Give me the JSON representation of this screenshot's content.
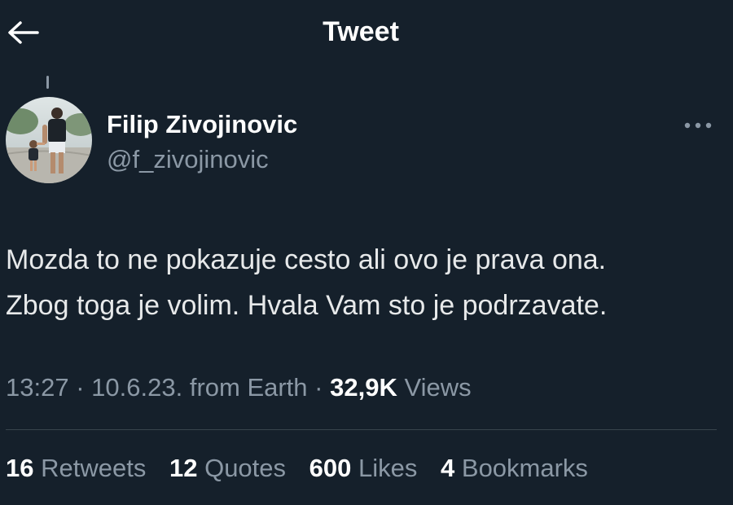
{
  "header": {
    "title": "Tweet",
    "back_icon": "arrow-left-icon"
  },
  "tweet": {
    "author": {
      "display_name": "Filip Zivojinovic",
      "handle": "@f_zivojinovic",
      "avatar_icon": "profile-photo"
    },
    "more_icon": "more-options-icon",
    "text_lines": [
      "Mozda to ne pokazuje cesto ali ovo je prava ona.",
      "Zbog toga je volim. Hvala Vam sto je podrzavate."
    ],
    "time": "13:27",
    "date": "10.6.23.",
    "source": "from Earth",
    "sep": "·",
    "views_count": "32,9K",
    "views_label": "Views"
  },
  "stats": {
    "retweets": {
      "count": "16",
      "label": "Retweets"
    },
    "quotes": {
      "count": "12",
      "label": "Quotes"
    },
    "likes": {
      "count": "600",
      "label": "Likes"
    },
    "bookmarks": {
      "count": "4",
      "label": "Bookmarks"
    }
  },
  "colors": {
    "background": "#15202b",
    "primary_text": "#e7e9ea",
    "secondary_text": "#8b98a5",
    "divider": "#38444d"
  }
}
